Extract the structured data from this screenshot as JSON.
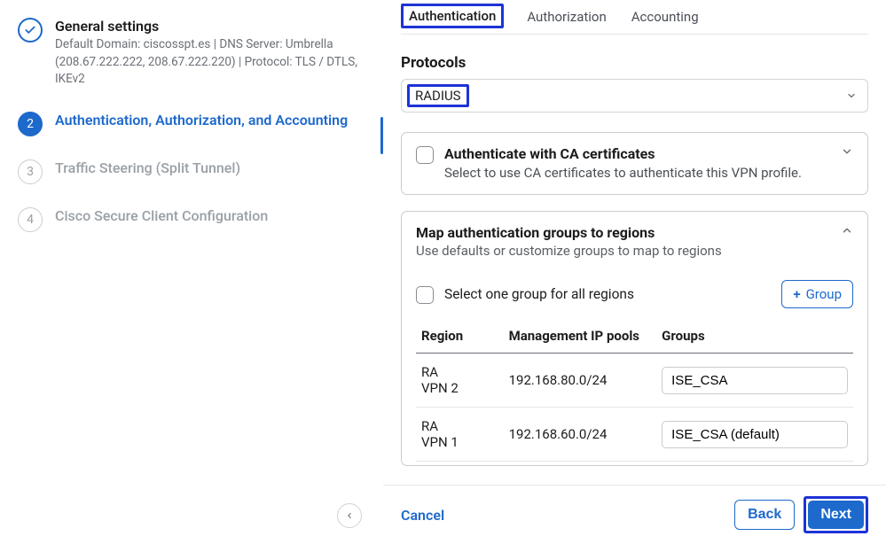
{
  "sidebar": {
    "steps": [
      {
        "title": "General settings",
        "sub": "Default Domain: ciscosspt.es | DNS Server: Umbrella (208.67.222.222, 208.67.222.220) | Protocol: TLS / DTLS, IKEv2"
      },
      {
        "num": "2",
        "title": "Authentication, Authorization, and Accounting"
      },
      {
        "num": "3",
        "title": "Traffic Steering (Split Tunnel)"
      },
      {
        "num": "4",
        "title": "Cisco Secure Client Configuration"
      }
    ]
  },
  "tabs": {
    "authentication": "Authentication",
    "authorization": "Authorization",
    "accounting": "Accounting"
  },
  "protocols": {
    "label": "Protocols",
    "value": "RADIUS"
  },
  "ca_panel": {
    "title": "Authenticate with CA certificates",
    "sub": "Select to use CA certificates to authenticate this VPN profile."
  },
  "map_panel": {
    "title": "Map authentication groups to regions",
    "sub": "Use defaults or customize groups to map to regions",
    "select_all": "Select one group for all regions",
    "group_btn": "Group",
    "cols": {
      "region": "Region",
      "pools": "Management IP pools",
      "groups": "Groups"
    },
    "rows": [
      {
        "region_l1": "RA",
        "region_l2": "VPN 2",
        "pool": "192.168.80.0/24",
        "group": "ISE_CSA"
      },
      {
        "region_l1": "RA",
        "region_l2": "VPN 1",
        "pool": "192.168.60.0/24",
        "group": "ISE_CSA (default)"
      }
    ]
  },
  "footer": {
    "cancel": "Cancel",
    "back": "Back",
    "next": "Next"
  }
}
